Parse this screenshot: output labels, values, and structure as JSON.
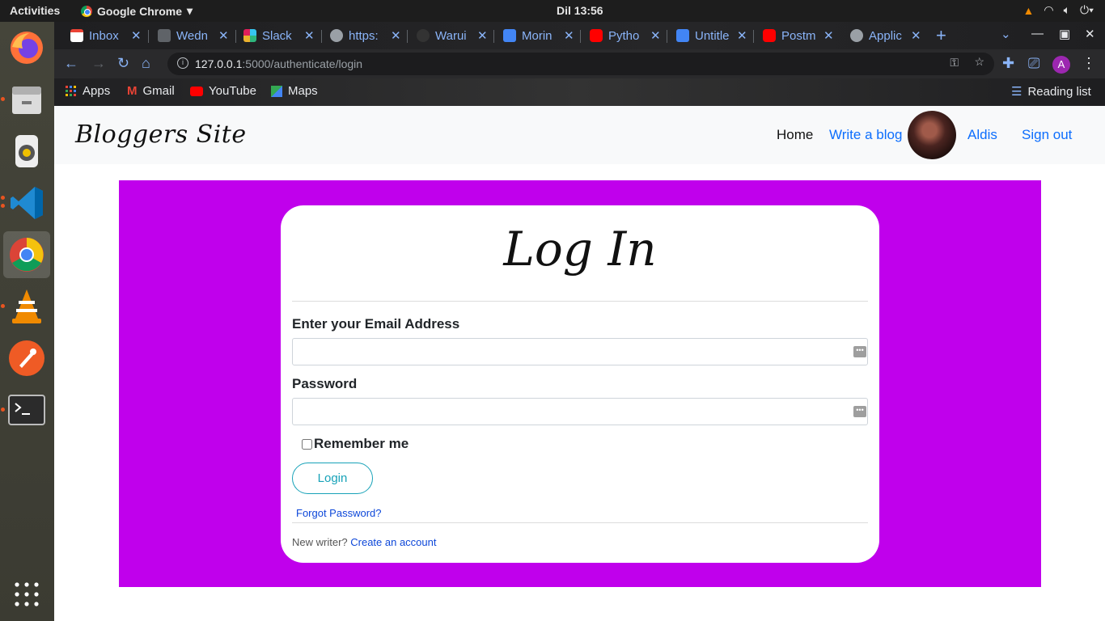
{
  "system": {
    "activities": "Activities",
    "app_name": "Google Chrome",
    "clock": "Dil 13:56"
  },
  "browser": {
    "tabs": [
      {
        "label": "Inbox",
        "favicon": "gmail-icon",
        "color": "#ea4335"
      },
      {
        "label": "Wedn",
        "favicon": "tree-icon",
        "color": "#5f6368"
      },
      {
        "label": "Slack |",
        "favicon": "slack-icon",
        "color": "#e01e5a"
      },
      {
        "label": "https:",
        "favicon": "globe-icon",
        "color": "#9aa0a6"
      },
      {
        "label": "Warui",
        "favicon": "github-icon",
        "color": "#333333"
      },
      {
        "label": "Morin",
        "favicon": "calendar-icon",
        "color": "#4285f4"
      },
      {
        "label": "Pytho",
        "favicon": "youtube-icon",
        "color": "#ff0000"
      },
      {
        "label": "Untitle",
        "favicon": "docs-icon",
        "color": "#4285f4"
      },
      {
        "label": "Postm",
        "favicon": "youtube-icon",
        "color": "#ff0000"
      },
      {
        "label": "Applic",
        "favicon": "globe-icon",
        "color": "#9aa0a6"
      }
    ],
    "url_host": "127.0.0.1",
    "url_path": ":5000/authenticate/login",
    "profile_initial": "A",
    "bookmarks": [
      {
        "label": "Apps",
        "icon": "apps-grid-icon"
      },
      {
        "label": "Gmail",
        "icon": "gmail-icon"
      },
      {
        "label": "YouTube",
        "icon": "youtube-icon"
      },
      {
        "label": "Maps",
        "icon": "maps-icon"
      }
    ],
    "reading_list": "Reading list"
  },
  "site": {
    "brand": "Bloggers Site",
    "nav": {
      "home": "Home",
      "write": "Write a blog",
      "user": "Aldis",
      "signout": "Sign out"
    },
    "login": {
      "title": "Log In",
      "email_label": "Enter your Email Address",
      "email_value": "",
      "password_label": "Password",
      "password_value": "",
      "remember_label": "Remember me",
      "button": "Login",
      "forgot": "Forgot Password?",
      "new_writer": "New writer?",
      "create_account": "Create an account"
    },
    "colors": {
      "panel": "#c000ec",
      "link": "#0d6efd",
      "button": "#17a2b8"
    }
  }
}
